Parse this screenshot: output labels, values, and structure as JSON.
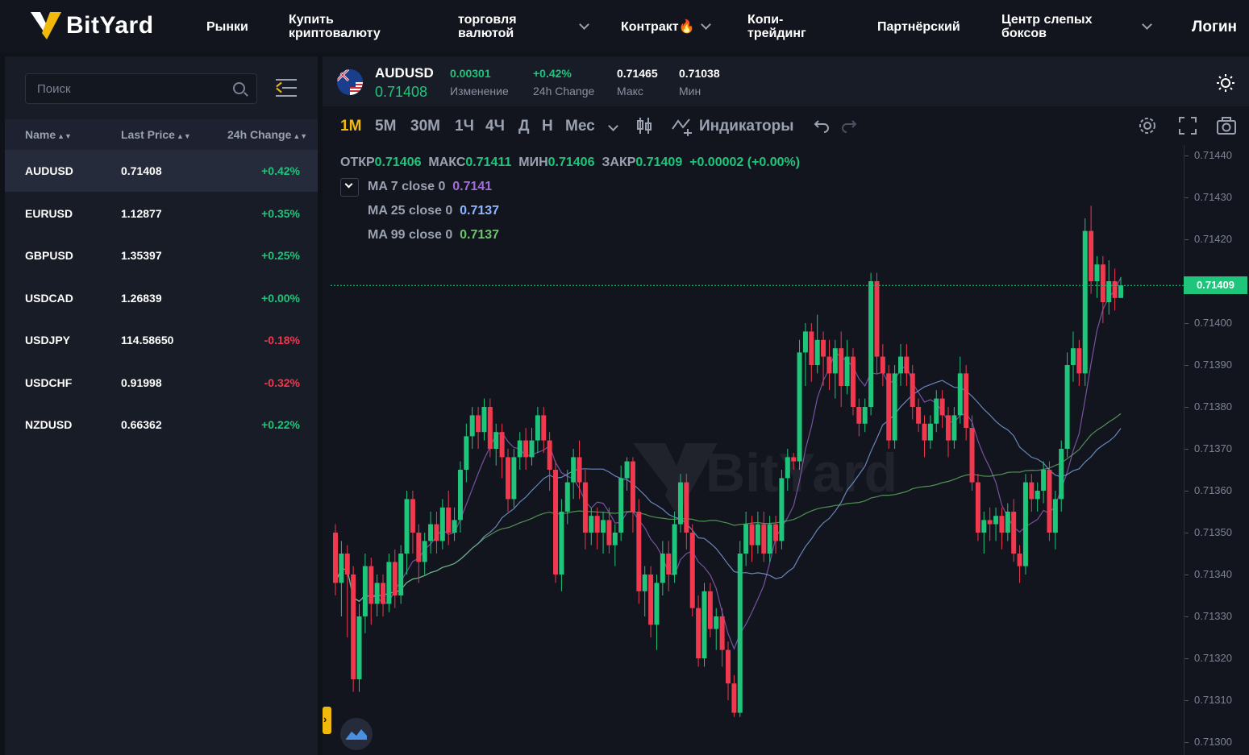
{
  "nav": {
    "logo": "BitYard",
    "items": [
      {
        "label": "Рынки"
      },
      {
        "label": "Купить\nкриптовалюту"
      },
      {
        "label": "торговля\nвалютой"
      },
      {
        "label": "Контракт🔥"
      },
      {
        "label": "Копи-\nтрейдинг"
      },
      {
        "label": "Партнёрский"
      },
      {
        "label": "Центр слепых\nбоксов"
      }
    ],
    "login": "Логин"
  },
  "sidebar": {
    "search_placeholder": "Поиск",
    "columns": [
      "Name",
      "Last Price",
      "24h Change"
    ],
    "rows": [
      {
        "name": "AUDUSD",
        "price": "0.71408",
        "change": "+0.42%",
        "dir": "up"
      },
      {
        "name": "EURUSD",
        "price": "1.12877",
        "change": "+0.35%",
        "dir": "up"
      },
      {
        "name": "GBPUSD",
        "price": "1.35397",
        "change": "+0.25%",
        "dir": "up"
      },
      {
        "name": "USDCAD",
        "price": "1.26839",
        "change": "+0.00%",
        "dir": "up"
      },
      {
        "name": "USDJPY",
        "price": "114.58650",
        "change": "-0.18%",
        "dir": "down"
      },
      {
        "name": "USDCHF",
        "price": "0.91998",
        "change": "-0.32%",
        "dir": "down"
      },
      {
        "name": "NZDUSD",
        "price": "0.66362",
        "change": "+0.22%",
        "dir": "up"
      }
    ]
  },
  "ticker": {
    "symbol": "AUDUSD",
    "price": "0.71408",
    "change_value": "0.00301",
    "change_label": "Изменение",
    "change_pct": "+0.42%",
    "change_pct_label": "24h Change",
    "high": "0.71465",
    "high_label": "Макс",
    "low": "0.71038",
    "low_label": "Мин"
  },
  "toolbar": {
    "timeframes": [
      "1M",
      "5M",
      "30M",
      "1Ч",
      "4Ч",
      "Д",
      "Н",
      "Мес"
    ],
    "selected": "1M",
    "indicators_label": "Индикаторы"
  },
  "chart_legend": {
    "ohlc": [
      {
        "label": "ОТКР",
        "value": "0.71406"
      },
      {
        "label": "МАКС",
        "value": "0.71411"
      },
      {
        "label": "МИН",
        "value": "0.71406"
      },
      {
        "label": "ЗАКР",
        "value": "0.71409"
      }
    ],
    "change": "+0.00002 (+0.00%)",
    "ma": [
      {
        "label": "MA 7 close 0",
        "value": "0.7141",
        "color": "#a56bd8"
      },
      {
        "label": "MA 25 close 0",
        "value": "0.7137",
        "color": "#8fb6ff"
      },
      {
        "label": "MA 99 close 0",
        "value": "0.7137",
        "color": "#6cc46c"
      }
    ]
  },
  "colors": {
    "up": "#1ec57a",
    "down": "#f0384f",
    "accent": "#f0b90b"
  },
  "chart_data": {
    "type": "candlestick",
    "ylim": [
      0.713,
      0.7144
    ],
    "yticks": [
      "0.71440",
      "0.71430",
      "0.71420",
      "0.71410",
      "0.71400",
      "0.71390",
      "0.71380",
      "0.71370",
      "0.71360",
      "0.71350",
      "0.71340",
      "0.71330",
      "0.71320",
      "0.71310",
      "0.71300"
    ],
    "last_price": "0.71409",
    "candles": [
      [
        0.7135,
        0.71338,
        0.71352,
        0.71335
      ],
      [
        0.71338,
        0.71345,
        0.71348,
        0.7133
      ],
      [
        0.71345,
        0.7134,
        0.71347,
        0.71325
      ],
      [
        0.7134,
        0.71315,
        0.71342,
        0.71312
      ],
      [
        0.71315,
        0.7133,
        0.71333,
        0.71312
      ],
      [
        0.7133,
        0.71342,
        0.71345,
        0.71326
      ],
      [
        0.71342,
        0.71333,
        0.71344,
        0.71328
      ],
      [
        0.71333,
        0.71338,
        0.7134,
        0.7133
      ],
      [
        0.71338,
        0.71333,
        0.7134,
        0.7133
      ],
      [
        0.71333,
        0.71343,
        0.71345,
        0.71331
      ],
      [
        0.71343,
        0.71335,
        0.71346,
        0.71332
      ],
      [
        0.71335,
        0.71345,
        0.71347,
        0.71333
      ],
      [
        0.71345,
        0.71358,
        0.7136,
        0.7134
      ],
      [
        0.71358,
        0.7135,
        0.7136,
        0.71345
      ],
      [
        0.7135,
        0.71343,
        0.71352,
        0.71338
      ],
      [
        0.71343,
        0.71348,
        0.7135,
        0.7134
      ],
      [
        0.71348,
        0.71352,
        0.71355,
        0.71345
      ],
      [
        0.71352,
        0.71348,
        0.71355,
        0.71345
      ],
      [
        0.71348,
        0.71356,
        0.71358,
        0.71346
      ],
      [
        0.71356,
        0.7135,
        0.7136,
        0.71347
      ],
      [
        0.7135,
        0.71353,
        0.71356,
        0.71348
      ],
      [
        0.71353,
        0.71365,
        0.71367,
        0.7135
      ],
      [
        0.71365,
        0.71373,
        0.71376,
        0.71362
      ],
      [
        0.71373,
        0.71378,
        0.7138,
        0.7137
      ],
      [
        0.71378,
        0.71374,
        0.7138,
        0.7137
      ],
      [
        0.71374,
        0.7138,
        0.71382,
        0.71372
      ],
      [
        0.7138,
        0.7137,
        0.71382,
        0.71368
      ],
      [
        0.7137,
        0.71374,
        0.71376,
        0.71366
      ],
      [
        0.71374,
        0.71368,
        0.71376,
        0.71363
      ],
      [
        0.71368,
        0.71358,
        0.7137,
        0.71355
      ],
      [
        0.71358,
        0.71368,
        0.7137,
        0.71356
      ],
      [
        0.71368,
        0.71372,
        0.71374,
        0.71365
      ],
      [
        0.71372,
        0.71368,
        0.71375,
        0.71365
      ],
      [
        0.71368,
        0.71372,
        0.71375,
        0.71366
      ],
      [
        0.71372,
        0.71378,
        0.7138,
        0.71369
      ],
      [
        0.71378,
        0.71372,
        0.7138,
        0.71369
      ],
      [
        0.71372,
        0.71365,
        0.71374,
        0.7136
      ],
      [
        0.71365,
        0.7134,
        0.71367,
        0.71338
      ],
      [
        0.7134,
        0.71355,
        0.71358,
        0.71336
      ],
      [
        0.71355,
        0.71362,
        0.71365,
        0.71352
      ],
      [
        0.71362,
        0.71368,
        0.7137,
        0.71358
      ],
      [
        0.71368,
        0.71362,
        0.71372,
        0.71358
      ],
      [
        0.71362,
        0.7135,
        0.71365,
        0.71346
      ],
      [
        0.7135,
        0.71354,
        0.71356,
        0.71347
      ],
      [
        0.71354,
        0.7135,
        0.71356,
        0.71346
      ],
      [
        0.7135,
        0.71353,
        0.71355,
        0.71345
      ],
      [
        0.71353,
        0.71347,
        0.71356,
        0.71345
      ],
      [
        0.71347,
        0.7135,
        0.71352,
        0.71342
      ],
      [
        0.7135,
        0.71363,
        0.71366,
        0.71348
      ],
      [
        0.71363,
        0.71367,
        0.71368,
        0.7136
      ],
      [
        0.71367,
        0.71355,
        0.71368,
        0.7135
      ],
      [
        0.71355,
        0.71336,
        0.71358,
        0.71333
      ],
      [
        0.71336,
        0.7134,
        0.71342,
        0.7133
      ],
      [
        0.7134,
        0.71328,
        0.71342,
        0.71325
      ],
      [
        0.71328,
        0.71338,
        0.7134,
        0.71322
      ],
      [
        0.71338,
        0.71345,
        0.71348,
        0.71335
      ],
      [
        0.71345,
        0.7134,
        0.71348,
        0.71336
      ],
      [
        0.7134,
        0.71352,
        0.71355,
        0.71338
      ],
      [
        0.71352,
        0.71362,
        0.71364,
        0.7135
      ],
      [
        0.71362,
        0.7135,
        0.71364,
        0.71346
      ],
      [
        0.7135,
        0.71332,
        0.71352,
        0.7133
      ],
      [
        0.71332,
        0.7132,
        0.71335,
        0.71318
      ],
      [
        0.7132,
        0.71336,
        0.71338,
        0.71318
      ],
      [
        0.71336,
        0.71327,
        0.71338,
        0.71325
      ],
      [
        0.71327,
        0.7133,
        0.71332,
        0.71322
      ],
      [
        0.7133,
        0.71322,
        0.71332,
        0.71318
      ],
      [
        0.71322,
        0.71314,
        0.71324,
        0.7131
      ],
      [
        0.71314,
        0.71307,
        0.71316,
        0.71306
      ],
      [
        0.71307,
        0.71345,
        0.71348,
        0.71306
      ],
      [
        0.71345,
        0.71352,
        0.71355,
        0.71342
      ],
      [
        0.71352,
        0.71347,
        0.71354,
        0.71343
      ],
      [
        0.71347,
        0.71352,
        0.71355,
        0.71345
      ],
      [
        0.71352,
        0.71345,
        0.71355,
        0.71343
      ],
      [
        0.71345,
        0.71352,
        0.71354,
        0.71343
      ],
      [
        0.71352,
        0.71348,
        0.71354,
        0.71345
      ],
      [
        0.71348,
        0.71363,
        0.71365,
        0.71346
      ],
      [
        0.71363,
        0.71368,
        0.7137,
        0.7136
      ],
      [
        0.71368,
        0.71367,
        0.71369,
        0.71365
      ],
      [
        0.71367,
        0.71393,
        0.71396,
        0.71365
      ],
      [
        0.71393,
        0.71398,
        0.714,
        0.71385
      ],
      [
        0.71398,
        0.7139,
        0.714,
        0.71386
      ],
      [
        0.7139,
        0.71396,
        0.71402,
        0.71388
      ],
      [
        0.71396,
        0.71392,
        0.71398,
        0.71385
      ],
      [
        0.71392,
        0.71388,
        0.71396,
        0.71384
      ],
      [
        0.71388,
        0.71394,
        0.71396,
        0.71382
      ],
      [
        0.71394,
        0.71385,
        0.71398,
        0.7138
      ],
      [
        0.71385,
        0.71392,
        0.71396,
        0.71383
      ],
      [
        0.71392,
        0.7138,
        0.71394,
        0.71378
      ],
      [
        0.7138,
        0.71376,
        0.71382,
        0.71373
      ],
      [
        0.71376,
        0.7138,
        0.71382,
        0.71374
      ],
      [
        0.7138,
        0.7141,
        0.71412,
        0.71378
      ],
      [
        0.7141,
        0.71392,
        0.71412,
        0.71388
      ],
      [
        0.71392,
        0.71388,
        0.71395,
        0.71385
      ],
      [
        0.71388,
        0.71372,
        0.7139,
        0.7137
      ],
      [
        0.71372,
        0.71388,
        0.7139,
        0.7137
      ],
      [
        0.71388,
        0.71392,
        0.71395,
        0.71385
      ],
      [
        0.71392,
        0.71388,
        0.71395,
        0.71385
      ],
      [
        0.71388,
        0.7138,
        0.7139,
        0.71377
      ],
      [
        0.7138,
        0.71376,
        0.71382,
        0.71374
      ],
      [
        0.71376,
        0.71372,
        0.71378,
        0.71368
      ],
      [
        0.71372,
        0.71376,
        0.71378,
        0.7137
      ],
      [
        0.71376,
        0.71382,
        0.71384,
        0.71374
      ],
      [
        0.71382,
        0.71378,
        0.71384,
        0.71375
      ],
      [
        0.71378,
        0.71372,
        0.7138,
        0.71368
      ],
      [
        0.71372,
        0.71378,
        0.7138,
        0.7137
      ],
      [
        0.71378,
        0.71388,
        0.71392,
        0.71376
      ],
      [
        0.71388,
        0.71375,
        0.7139,
        0.71372
      ],
      [
        0.71375,
        0.71362,
        0.71378,
        0.7136
      ],
      [
        0.71362,
        0.7135,
        0.71364,
        0.71348
      ],
      [
        0.7135,
        0.71353,
        0.71355,
        0.71345
      ],
      [
        0.71353,
        0.71352,
        0.71356,
        0.71348
      ],
      [
        0.71352,
        0.71354,
        0.71356,
        0.71348
      ],
      [
        0.71354,
        0.7135,
        0.71356,
        0.71346
      ],
      [
        0.7135,
        0.71355,
        0.71357,
        0.71348
      ],
      [
        0.71355,
        0.71345,
        0.71358,
        0.71343
      ],
      [
        0.71345,
        0.71342,
        0.71347,
        0.71338
      ],
      [
        0.71342,
        0.71362,
        0.71364,
        0.7134
      ],
      [
        0.71362,
        0.71358,
        0.71364,
        0.71355
      ],
      [
        0.71358,
        0.7136,
        0.71362,
        0.71355
      ],
      [
        0.7136,
        0.71365,
        0.71367,
        0.71357
      ],
      [
        0.71365,
        0.7135,
        0.71367,
        0.71348
      ],
      [
        0.7135,
        0.71358,
        0.7136,
        0.71346
      ],
      [
        0.71358,
        0.7137,
        0.71372,
        0.71355
      ],
      [
        0.7137,
        0.7139,
        0.71393,
        0.71368
      ],
      [
        0.7139,
        0.71394,
        0.71398,
        0.71386
      ],
      [
        0.71394,
        0.71388,
        0.71396,
        0.71385
      ],
      [
        0.71388,
        0.71422,
        0.71425,
        0.71385
      ],
      [
        0.71422,
        0.7141,
        0.71428,
        0.71407
      ],
      [
        0.7141,
        0.71414,
        0.71416,
        0.71406
      ],
      [
        0.71414,
        0.71405,
        0.71416,
        0.714
      ],
      [
        0.71405,
        0.7141,
        0.71415,
        0.71402
      ],
      [
        0.7141,
        0.71406,
        0.71413,
        0.71403
      ],
      [
        0.71406,
        0.71409,
        0.71411,
        0.71406
      ]
    ]
  }
}
